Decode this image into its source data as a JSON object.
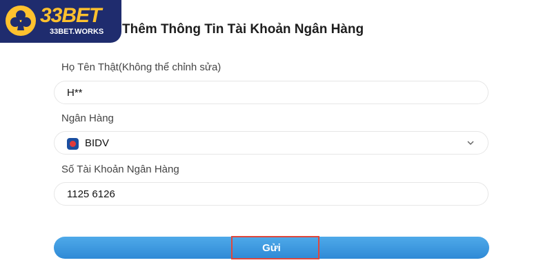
{
  "logo": {
    "brand": "33BET",
    "domain": "33BET.WORKS"
  },
  "page": {
    "title": "Thêm Thông Tin Tài Khoản Ngân Hàng"
  },
  "form": {
    "name_label": "Họ Tên Thật(Không thể chỉnh sửa)",
    "name_value": "H**",
    "bank_label": "Ngân Hàng",
    "bank_value": "BIDV",
    "account_label": "Số Tài Khoản Ngân Hàng",
    "account_value": "1125 6126",
    "submit_label": "Gửi"
  },
  "icons": {
    "bank": "bidv-logo-icon",
    "dropdown": "chevron-down-icon"
  },
  "colors": {
    "primary": "#2f8ad6",
    "highlight": "#e0473b",
    "logo_bg": "#1f2c6e",
    "logo_text": "#ffc12e"
  }
}
